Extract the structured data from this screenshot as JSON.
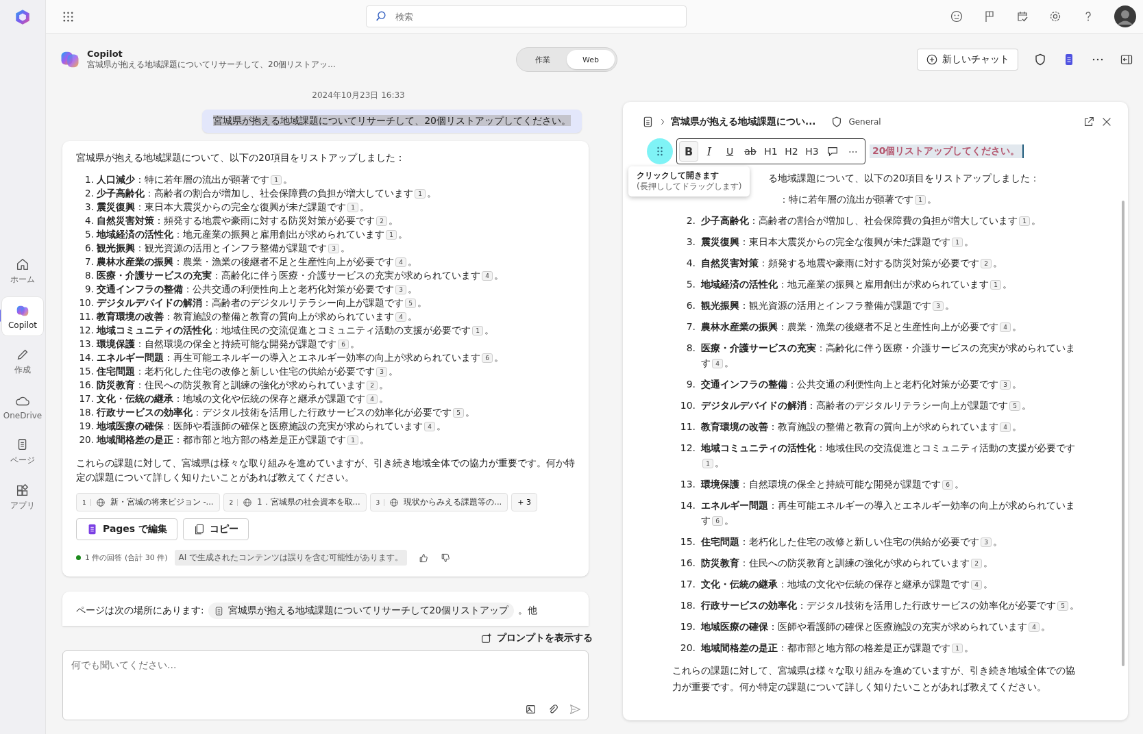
{
  "app_rail": {
    "items": [
      {
        "kind": "home",
        "label": "ホーム",
        "selected": false
      },
      {
        "kind": "copilot",
        "label": "Copilot",
        "selected": true
      },
      {
        "kind": "create",
        "label": "作成",
        "selected": false
      },
      {
        "kind": "onedrive",
        "label": "OneDrive",
        "selected": false
      },
      {
        "kind": "pages",
        "label": "ページ",
        "selected": false
      },
      {
        "kind": "apps",
        "label": "アプリ",
        "selected": false
      }
    ]
  },
  "top_bar": {
    "search": {
      "placeholder": "検索"
    }
  },
  "header": {
    "title": "Copilot",
    "subtitle": "宮城県が抱える地域課題についてリサーチして、20個リストアッ...",
    "modes": [
      {
        "label": "作業",
        "selected": false
      },
      {
        "label": "Web",
        "selected": true
      }
    ],
    "new_chat": "新しいチャット"
  },
  "chat": {
    "timestamp": "2024年10月23日 16:33",
    "user_message": "宮城県が抱える地域課題についてリサーチして、20個リストアップしてください。",
    "response": {
      "intro": "宮城県が抱える地域課題について、以下の20項目をリストアップしました：",
      "items": [
        {
          "number": "1.",
          "title": "人口減少",
          "text": "：特に若年層の流出が顕著です",
          "cite": "1",
          "tail": "。"
        },
        {
          "number": "2.",
          "title": "少子高齢化",
          "text": "：高齢者の割合が増加し、社会保障費の負担が増大しています",
          "cite": "1",
          "tail": "。"
        },
        {
          "number": "3.",
          "title": "震災復興",
          "text": "：東日本大震災からの完全な復興が未だ課題です",
          "cite": "1",
          "tail": "。"
        },
        {
          "number": "4.",
          "title": "自然災害対策",
          "text": "：頻発する地震や豪雨に対する防災対策が必要です",
          "cite": "2",
          "tail": "。"
        },
        {
          "number": "5.",
          "title": "地域経済の活性化",
          "text": "：地元産業の振興と雇用創出が求められています",
          "cite": "1",
          "tail": "。"
        },
        {
          "number": "6.",
          "title": "観光振興",
          "text": "：観光資源の活用とインフラ整備が課題です",
          "cite": "3",
          "tail": "。"
        },
        {
          "number": "7.",
          "title": "農林水産業の振興",
          "text": "：農業・漁業の後継者不足と生産性向上が必要です",
          "cite": "4",
          "tail": "。"
        },
        {
          "number": "8.",
          "title": "医療・介護サービスの充実",
          "text": "：高齢化に伴う医療・介護サービスの充実が求められています",
          "cite": "4",
          "tail": "。"
        },
        {
          "number": "9.",
          "title": "交通インフラの整備",
          "text": "：公共交通の利便性向上と老朽化対策が必要です",
          "cite": "3",
          "tail": "。"
        },
        {
          "number": "10.",
          "title": "デジタルデバイドの解消",
          "text": "：高齢者のデジタルリテラシー向上が課題です",
          "cite": "5",
          "tail": "。"
        },
        {
          "number": "11.",
          "title": "教育環境の改善",
          "text": "：教育施設の整備と教育の質向上が求められています",
          "cite": "4",
          "tail": "。"
        },
        {
          "number": "12.",
          "title": "地域コミュニティの活性化",
          "text": "：地域住民の交流促進とコミュニティ活動の支援が必要です",
          "cite": "1",
          "tail": "。"
        },
        {
          "number": "13.",
          "title": "環境保護",
          "text": "：自然環境の保全と持続可能な開発が課題です",
          "cite": "6",
          "tail": "。"
        },
        {
          "number": "14.",
          "title": "エネルギー問題",
          "text": "：再生可能エネルギーの導入とエネルギー効率の向上が求められています",
          "cite": "6",
          "tail": "。"
        },
        {
          "number": "15.",
          "title": "住宅問題",
          "text": "：老朽化した住宅の改修と新しい住宅の供給が必要です",
          "cite": "3",
          "tail": "。"
        },
        {
          "number": "16.",
          "title": "防災教育",
          "text": "：住民への防災教育と訓練の強化が求められています",
          "cite": "2",
          "tail": "。"
        },
        {
          "number": "17.",
          "title": "文化・伝統の継承",
          "text": "：地域の文化や伝統の保存と継承が課題です",
          "cite": "4",
          "tail": "。"
        },
        {
          "number": "18.",
          "title": "行政サービスの効率化",
          "text": "：デジタル技術を活用した行政サービスの効率化が必要です",
          "cite": "5",
          "tail": "。"
        },
        {
          "number": "19.",
          "title": "地域医療の確保",
          "text": "：医師や看護師の確保と医療施設の充実が求められています",
          "cite": "4",
          "tail": "。"
        },
        {
          "number": "20.",
          "title": "地域間格差の是正",
          "text": "：都市部と地方部の格差是正が課題です",
          "cite": "1",
          "tail": "。"
        }
      ],
      "closing": "これらの課題に対して、宮城県は様々な取り組みを進めていますが、引き続き地域全体での協力が重要です。何か特定の課題について詳しく知りたいことがあれば教えてください。",
      "citations": [
        {
          "number": "1",
          "title": "新・宮城の将来ビジョン -..."
        },
        {
          "number": "2",
          "title": "1．宮城県の社会資本を取..."
        },
        {
          "number": "3",
          "title": "現状からみえる課題等の..."
        }
      ],
      "more_citations": "+ 3",
      "buttons": [
        {
          "kind": "pages",
          "label": "Pages で編集"
        },
        {
          "kind": "copy",
          "label": "コピー"
        }
      ],
      "response_count": "1 件の回答 (合計 30 件)",
      "disclaimer": "AI で生成されたコンテンツは誤りを含む可能性があります。"
    },
    "notice": {
      "text": "ページは次の場所にあります:",
      "page_link": "宮城県が抱える地域課題についてリサーチして20個リストアップ",
      "tail": "。他"
    },
    "show_prompts": "プロンプトを表示する",
    "input": {
      "placeholder": "何でも聞いてください..."
    }
  },
  "page_panel": {
    "title": "宮城県が抱える地域課題につい...",
    "label": "General",
    "heading": "20個リストアップしてください。",
    "toolbar": [
      {
        "kind": "bold",
        "label": "B",
        "selected": true
      },
      {
        "kind": "italic",
        "label": "I",
        "selected": false
      },
      {
        "kind": "underline",
        "label": "U",
        "selected": false
      },
      {
        "kind": "strike",
        "label": "ab",
        "selected": false
      },
      {
        "kind": "text",
        "label": "H1",
        "selected": false
      },
      {
        "kind": "text",
        "label": "H2",
        "selected": false
      },
      {
        "kind": "text",
        "label": "H3",
        "selected": false
      },
      {
        "kind": "comment",
        "selected": false
      },
      {
        "kind": "text",
        "label": "⋯",
        "selected": false
      }
    ],
    "tooltip": {
      "title": "クリックして開きます",
      "hint": "(長押ししてドラッグします)"
    },
    "intro": "る地域課題について、以下の20項目をリストアップしました：",
    "items": [
      {
        "text": "：特に若年層の流出が顕著です",
        "cite": "1",
        "tail": "。"
      },
      {
        "number": "2.",
        "title": "少子高齢化",
        "text": "：高齢者の割合が増加し、社会保障費の負担が増大しています",
        "cite": "1",
        "tail": "。"
      },
      {
        "number": "3.",
        "title": "震災復興",
        "text": "：東日本大震災からの完全な復興が未だ課題です",
        "cite": "1",
        "tail": "。"
      },
      {
        "number": "4.",
        "title": "自然災害対策",
        "text": "：頻発する地震や豪雨に対する防災対策が必要です",
        "cite": "2",
        "tail": "。"
      },
      {
        "number": "5.",
        "title": "地域経済の活性化",
        "text": "：地元産業の振興と雇用創出が求められています",
        "cite": "1",
        "tail": "。"
      },
      {
        "number": "6.",
        "title": "観光振興",
        "text": "：観光資源の活用とインフラ整備が課題です",
        "cite": "3",
        "tail": "。"
      },
      {
        "number": "7.",
        "title": "農林水産業の振興",
        "text": "：農業・漁業の後継者不足と生産性向上が必要です",
        "cite": "4",
        "tail": "。"
      },
      {
        "number": "8.",
        "title": "医療・介護サービスの充実",
        "text": "：高齢化に伴う医療・介護サービスの充実が求められています",
        "cite": "4",
        "tail": "。"
      },
      {
        "number": "9.",
        "title": "交通インフラの整備",
        "text": "：公共交通の利便性向上と老朽化対策が必要です",
        "cite": "3",
        "tail": "。"
      },
      {
        "number": "10.",
        "title": "デジタルデバイドの解消",
        "text": "：高齢者のデジタルリテラシー向上が課題です",
        "cite": "5",
        "tail": "。"
      },
      {
        "number": "11.",
        "title": "教育環境の改善",
        "text": "：教育施設の整備と教育の質向上が求められています",
        "cite": "4",
        "tail": "。"
      },
      {
        "number": "12.",
        "title": "地域コミュニティの活性化",
        "text": "：地域住民の交流促進とコミュニティ活動の支援が必要です",
        "cite": "1",
        "tail": "。"
      },
      {
        "number": "13.",
        "title": "環境保護",
        "text": "：自然環境の保全と持続可能な開発が課題です",
        "cite": "6",
        "tail": "。"
      },
      {
        "number": "14.",
        "title": "エネルギー問題",
        "text": "：再生可能エネルギーの導入とエネルギー効率の向上が求められています",
        "cite": "6",
        "tail": "。"
      },
      {
        "number": "15.",
        "title": "住宅問題",
        "text": "：老朽化した住宅の改修と新しい住宅の供給が必要です",
        "cite": "3",
        "tail": "。"
      },
      {
        "number": "16.",
        "title": "防災教育",
        "text": "：住民への防災教育と訓練の強化が求められています",
        "cite": "2",
        "tail": "。"
      },
      {
        "number": "17.",
        "title": "文化・伝統の継承",
        "text": "：地域の文化や伝統の保存と継承が課題です",
        "cite": "4",
        "tail": "。"
      },
      {
        "number": "18.",
        "title": "行政サービスの効率化",
        "text": "：デジタル技術を活用した行政サービスの効率化が必要です",
        "cite": "5",
        "tail": "。"
      },
      {
        "number": "19.",
        "title": "地域医療の確保",
        "text": "：医師や看護師の確保と医療施設の充実が求められています",
        "cite": "4",
        "tail": "。"
      },
      {
        "number": "20.",
        "title": "地域間格差の是正",
        "text": "：都市部と地方部の格差是正が課題です",
        "cite": "1",
        "tail": "。"
      }
    ],
    "closing": "これらの課題に対して、宮城県は様々な取り組みを進めていますが、引き続き地域全体での協力が重要です。何か特定の課題について詳しく知りたいことがあれば教えてください。"
  }
}
